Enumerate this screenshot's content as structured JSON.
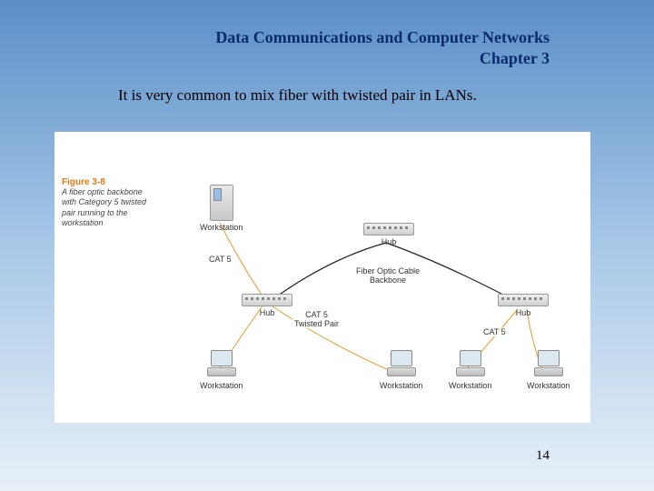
{
  "header": {
    "title_line1": "Data Communications and Computer Networks",
    "title_line2": "Chapter 3"
  },
  "body": {
    "text": "It is very common to mix fiber with twisted pair in LANs."
  },
  "figure": {
    "number": "Figure 3-8",
    "caption": "A fiber optic backbone with Category 5 twisted pair running to the workstation",
    "labels": {
      "workstation": "Workstation",
      "hub": "Hub",
      "cat5": "CAT 5",
      "cat5_twisted": "CAT 5 Twisted Pair",
      "backbone_line1": "Fiber Optic Cable",
      "backbone_line2": "Backbone"
    }
  },
  "page_number": "14"
}
